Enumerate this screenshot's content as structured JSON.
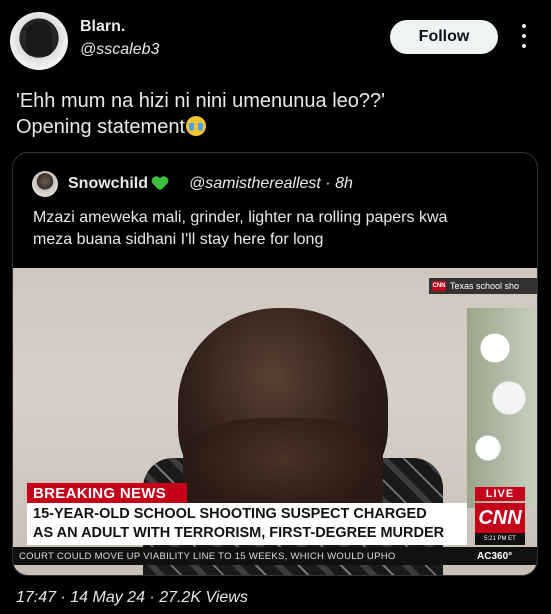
{
  "author": {
    "name": "Blarn.",
    "handle": "@sscaleb3"
  },
  "follow_label": "Follow",
  "tweet": {
    "line1": "'Ehh mum na hizi ni nini umenunua leo??'",
    "line2": "Opening statement",
    "emoji": "crying-face-emoji"
  },
  "quote": {
    "name": "Snowchild",
    "handle_time": "@samisthereallest · 8h",
    "text": "Mzazi ameweka mali, grinder, lighter na rolling papers kwa\nmeza buana sidhani I'll stay here for long",
    "media": {
      "top_badge": "Texas school sho",
      "network_small": "CNN",
      "breaking": "BREAKING NEWS",
      "headline": "15-YEAR-OLD SCHOOL SHOOTING SUSPECT CHARGED\nAS AN ADULT WITH TERRORISM, FIRST-DEGREE MURDER",
      "live": "LIVE",
      "logo": "CNN",
      "logo_time": "5:21 PM ET",
      "ticker": "COURT COULD MOVE UP VIABILITY LINE TO 15 WEEKS, WHICH WOULD UPHO",
      "show": "AC360°"
    }
  },
  "meta": "17:47 · 14 May 24 · 27.2K Views",
  "colors": {
    "background": "#000000",
    "text": "#e7e9ea",
    "cnn_red": "#c4001a",
    "heart": "#3fbf3f"
  }
}
